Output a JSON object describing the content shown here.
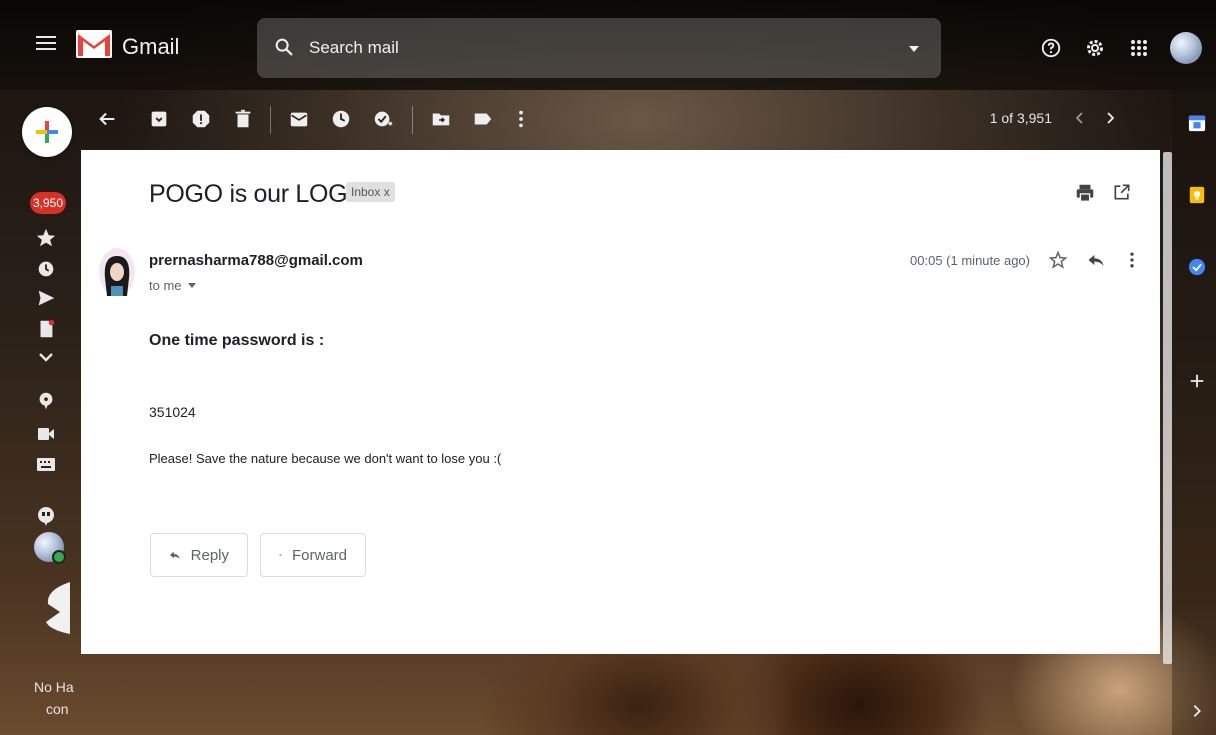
{
  "header": {
    "brand": "Gmail",
    "search_placeholder": "Search mail"
  },
  "rail": {
    "badge_count": "3,950"
  },
  "toolbar": {
    "pager_text": "1 of 3,951"
  },
  "email": {
    "subject": "POGO is our LOGO",
    "label": "Inbox x",
    "sender": "prernasharma788@gmail.com",
    "recipient": "to me",
    "time": "00:05 (1 minute ago)",
    "otp_heading": "One time password is :",
    "otp_value": "351024",
    "note": "Please! Save the nature because we don't want to lose you :("
  },
  "actions": {
    "reply_label": "Reply",
    "forward_label": "Forward"
  },
  "footer": {
    "line1": "No Ha",
    "line2": "con"
  },
  "colors": {
    "badge": "#d93025",
    "gmail_red": "#ea4335",
    "compose_blue": "#4285f4",
    "compose_green": "#34a853",
    "compose_yellow": "#fbbc04"
  }
}
